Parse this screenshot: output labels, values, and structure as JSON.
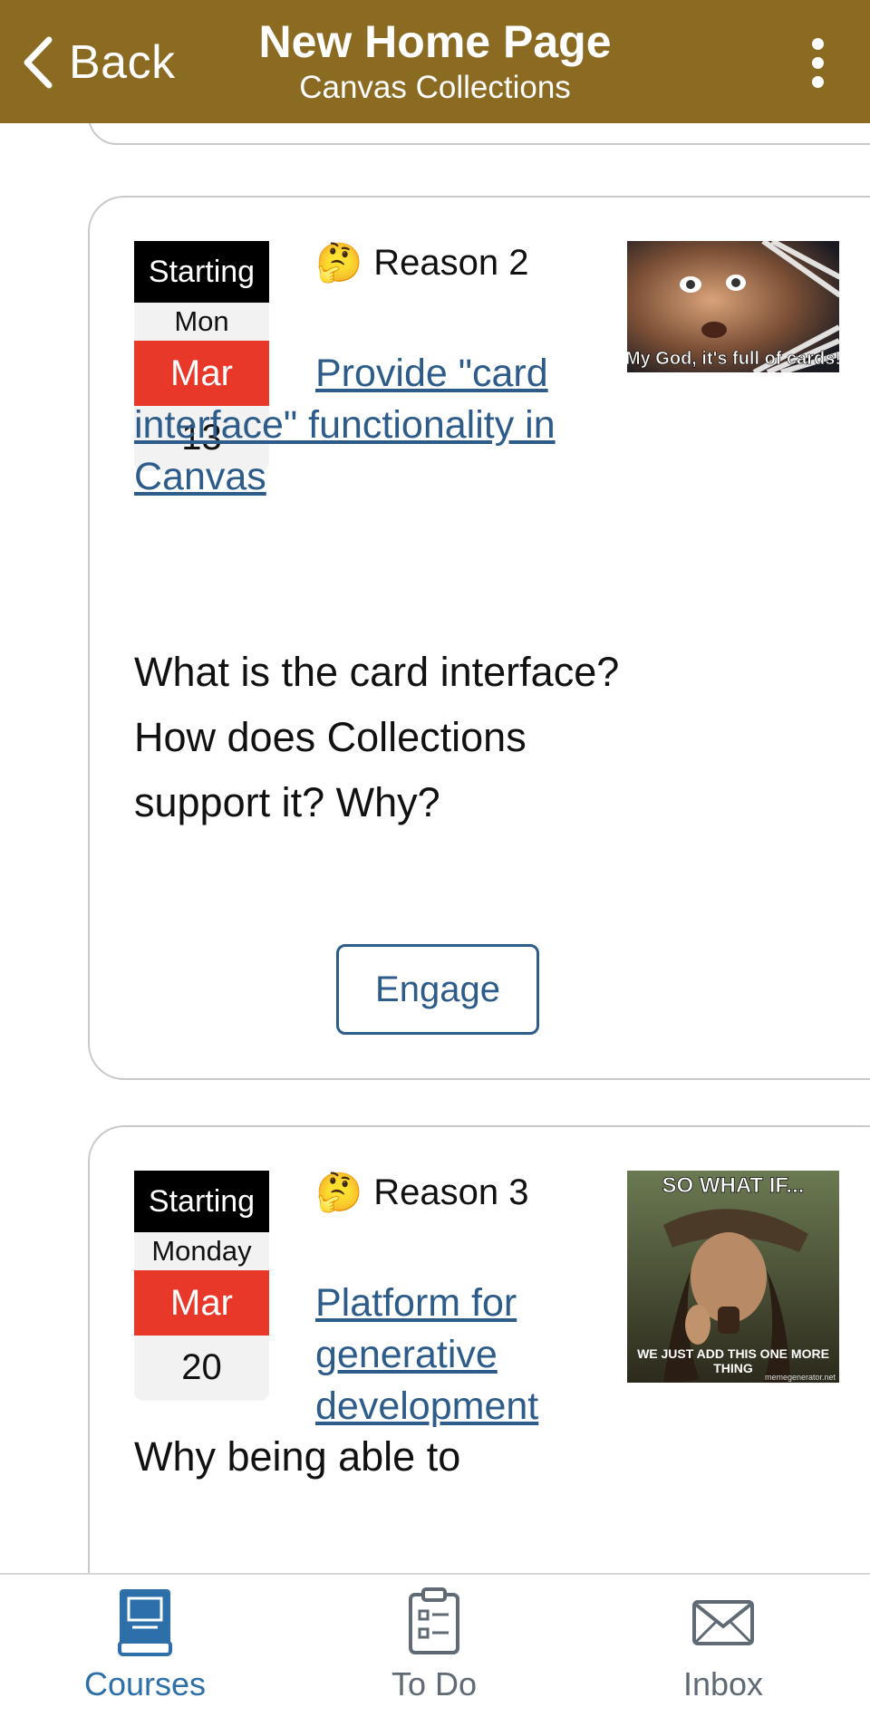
{
  "header": {
    "back_label": "Back",
    "title": "New Home Page",
    "subtitle": "Canvas Collections",
    "more_icon": "more-vertical-icon"
  },
  "cards": [
    {
      "date": {
        "starting": "Starting",
        "day_of_week": "Mon",
        "month": "Mar",
        "day": "13"
      },
      "reason_emoji": "🤔",
      "reason_label": "Reason 2",
      "link_text": "Provide \"card interface\" functionality in Canvas",
      "image_caption": "My God, it's full of cards!",
      "description": "What is the card interface? How does Collections support it? Why?",
      "engage_label": "Engage"
    },
    {
      "date": {
        "starting": "Starting",
        "day_of_week": "Monday",
        "month": "Mar",
        "day": "20"
      },
      "reason_emoji": "🤔",
      "reason_label": "Reason 3",
      "link_text": "Platform for generative development",
      "image_caption_top": "SO WHAT IF...",
      "image_caption_bottom": "WE JUST ADD THIS ONE MORE THING",
      "image_watermark": "memegenerator.net",
      "description": "Why being able to"
    }
  ],
  "tabbar": {
    "tabs": [
      {
        "label": "Courses",
        "icon": "book-icon",
        "active": true
      },
      {
        "label": "To Do",
        "icon": "clipboard-list-icon",
        "active": false
      },
      {
        "label": "Inbox",
        "icon": "envelope-icon",
        "active": false
      }
    ]
  },
  "colors": {
    "header_bg": "#8b6a22",
    "link": "#2d5c8a",
    "date_month_bg": "#e8382a",
    "tab_active": "#2d6fa8",
    "tab_inactive": "#5f6a74"
  }
}
